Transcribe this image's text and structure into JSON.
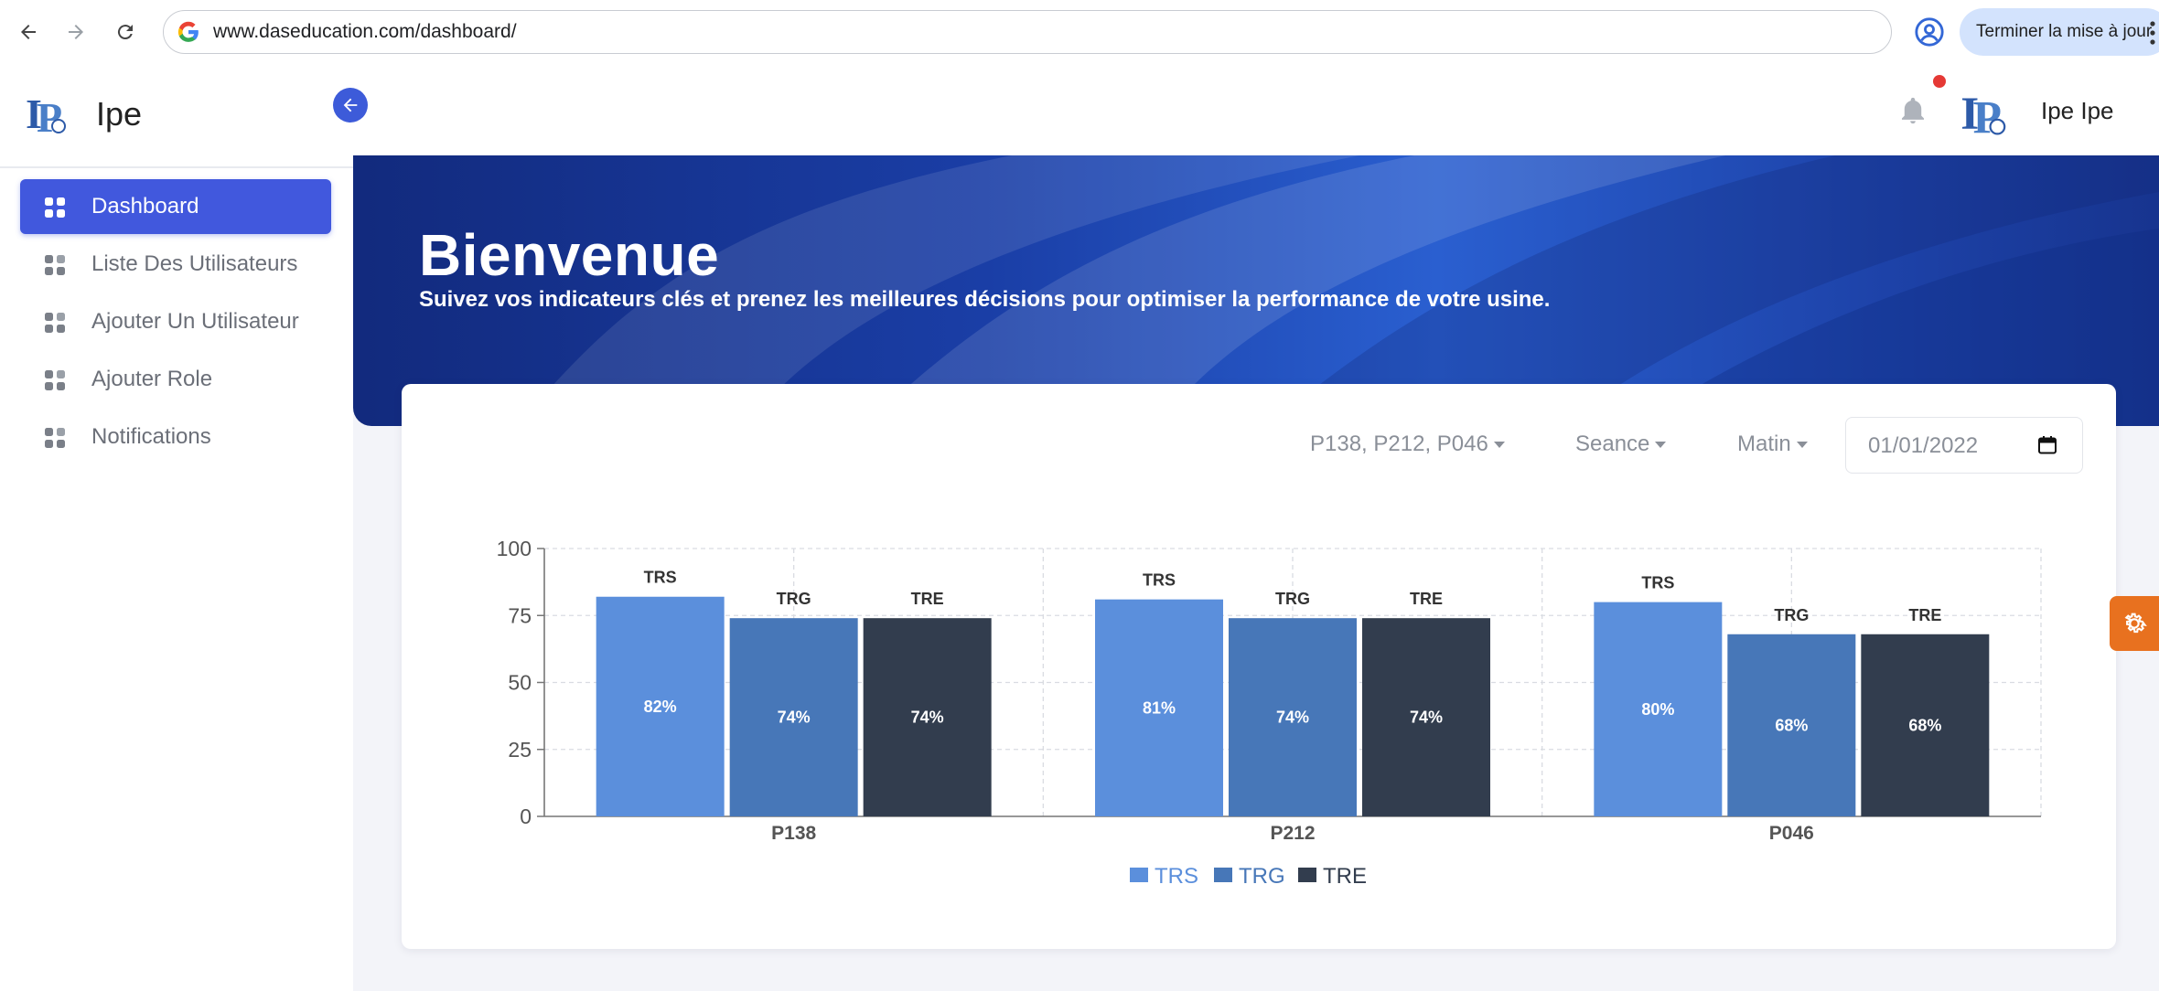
{
  "browser": {
    "url": "www.daseducation.com/dashboard/",
    "update_button": "Terminer la mise à jour"
  },
  "sidebar": {
    "brand": "Ipe",
    "items": [
      {
        "label": "Dashboard",
        "active": true
      },
      {
        "label": "Liste Des Utilisateurs",
        "active": false
      },
      {
        "label": "Ajouter Un Utilisateur",
        "active": false
      },
      {
        "label": "Ajouter Role",
        "active": false
      },
      {
        "label": "Notifications",
        "active": false
      }
    ]
  },
  "header": {
    "user_name": "Ipe Ipe",
    "has_notification": true
  },
  "hero": {
    "title": "Bienvenue",
    "subtitle": "Suivez vos indicateurs clés et prenez les meilleures décisions pour optimiser la performance de votre usine."
  },
  "filters": {
    "machines": "P138, P212, P046",
    "period": "Seance",
    "shift": "Matin",
    "date": "01/01/2022"
  },
  "colors": {
    "accent": "#4158dd",
    "trs": "#5b8fdc",
    "trg": "#4777b8",
    "tre": "#323d4e"
  },
  "chart_data": {
    "type": "bar",
    "categories": [
      "P138",
      "P212",
      "P046"
    ],
    "series": [
      {
        "name": "TRS",
        "values": [
          82,
          81,
          80
        ],
        "color": "#5b8fdc"
      },
      {
        "name": "TRG",
        "values": [
          74,
          74,
          68
        ],
        "color": "#4777b8"
      },
      {
        "name": "TRE",
        "values": [
          74,
          74,
          68
        ],
        "color": "#323d4e"
      }
    ],
    "value_suffix": "%",
    "yticks": [
      0,
      25,
      50,
      75,
      100
    ],
    "ylim": [
      0,
      100
    ],
    "grid": true,
    "legend_position": "bottom"
  }
}
